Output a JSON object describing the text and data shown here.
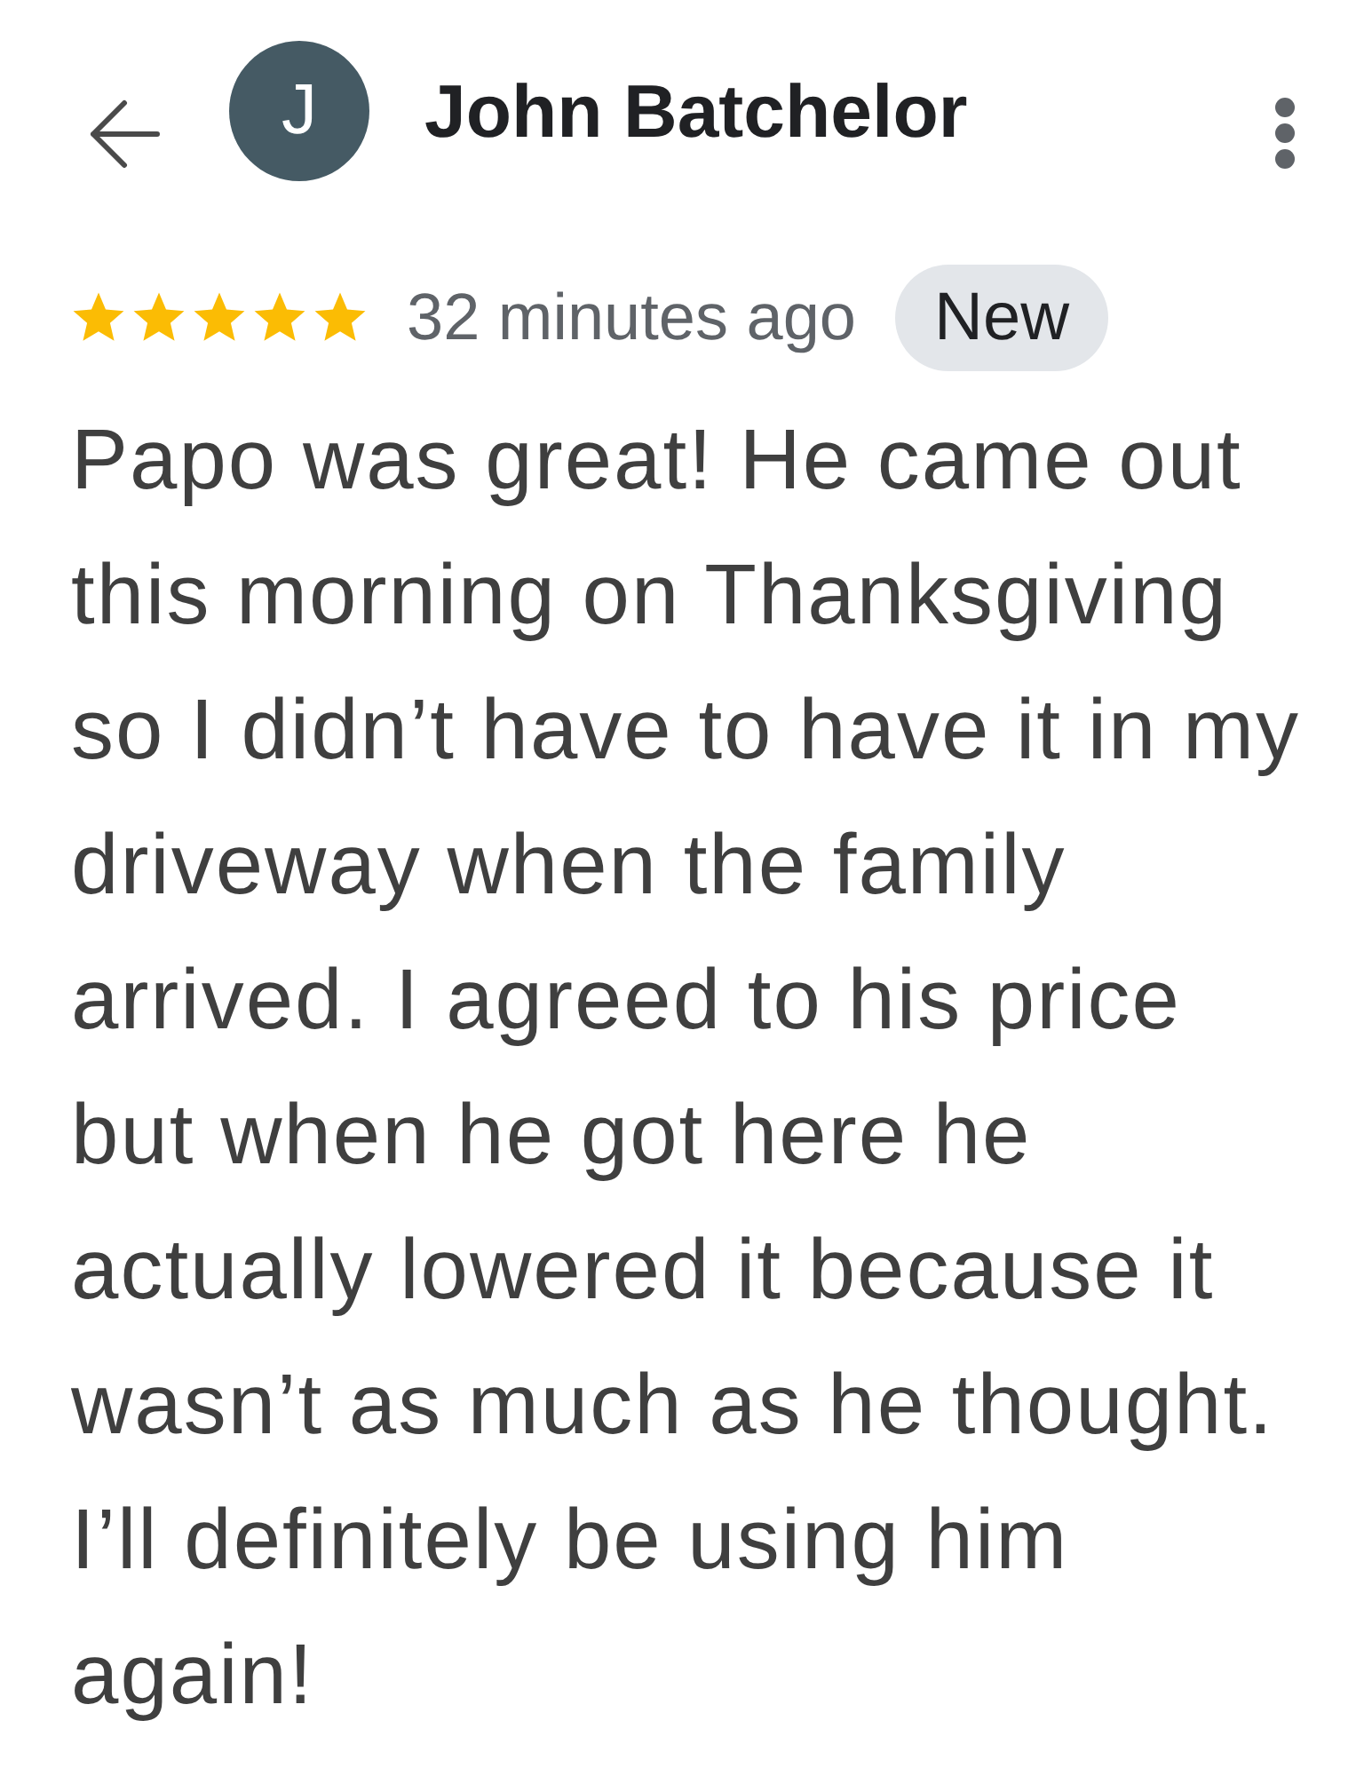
{
  "header": {
    "avatar_initial": "J",
    "reviewer_name": "John Batchelor"
  },
  "rating": {
    "stars": 5,
    "time": "32 minutes ago",
    "badge": "New"
  },
  "review_text": "Papo was great! He came out this morning on Thanksgiving so I didn’t have to have it in my driveway when the family arrived. I agreed to his price but when he got here he actually lowered it because it wasn’t as much as he thought. I’ll definitely be using him again!"
}
